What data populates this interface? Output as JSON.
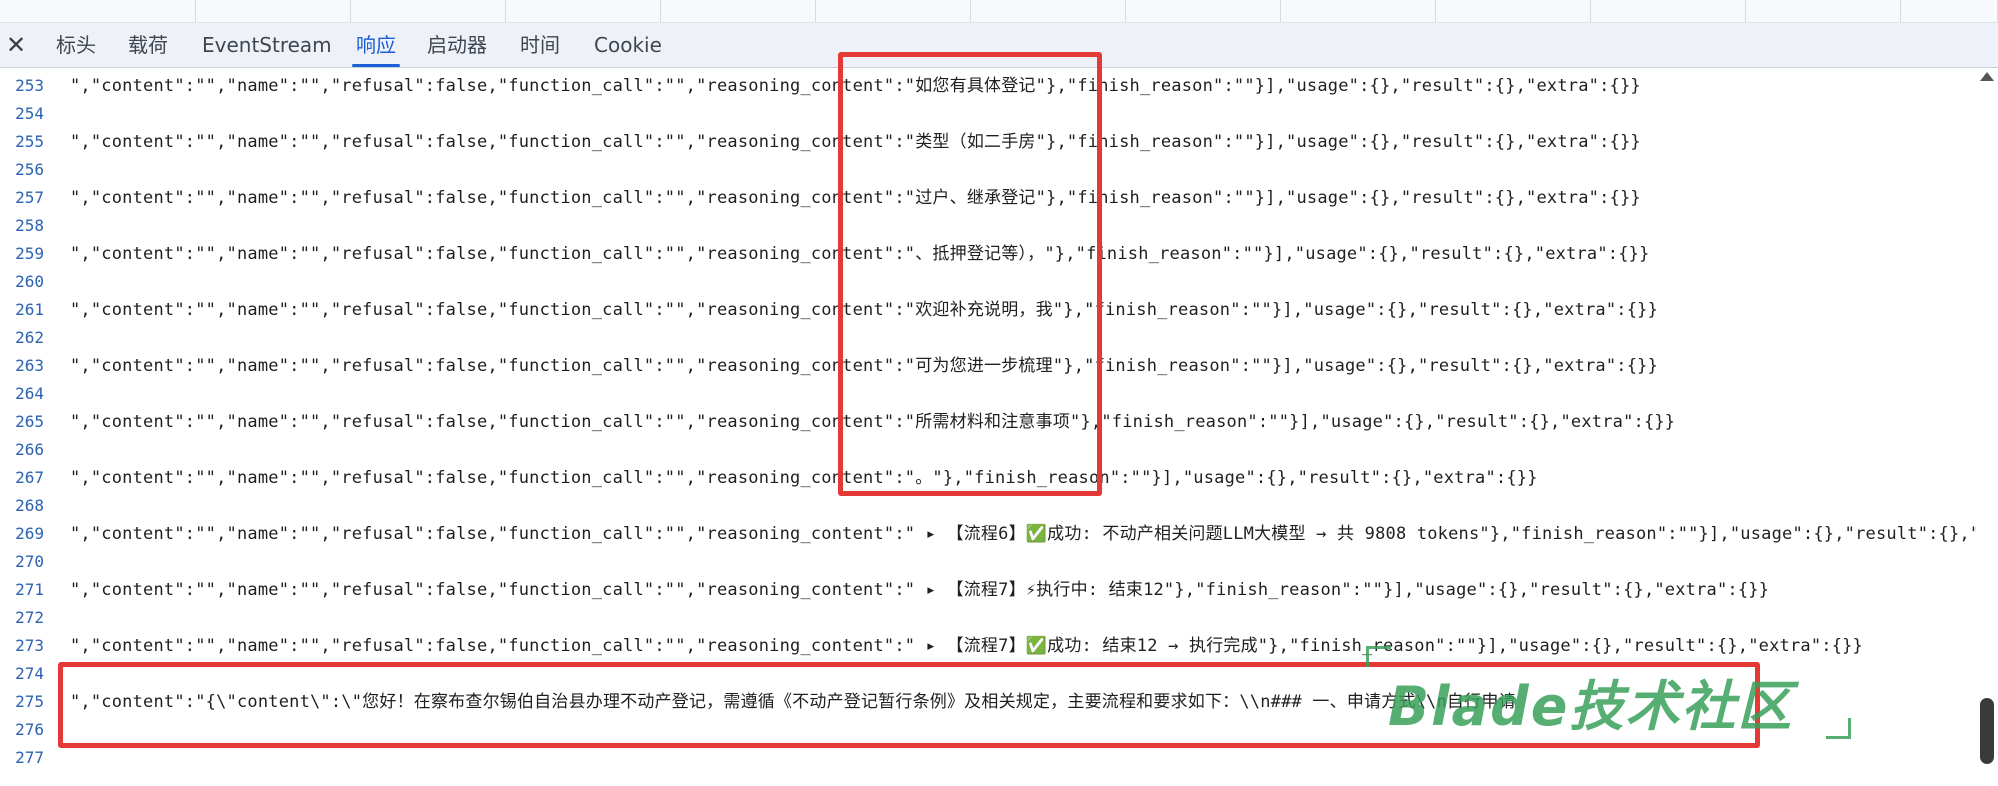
{
  "tabs": [
    {
      "label": "标头",
      "active": false
    },
    {
      "label": "载荷",
      "active": false
    },
    {
      "label": "EventStream",
      "active": false
    },
    {
      "label": "响应",
      "active": true
    },
    {
      "label": "启动器",
      "active": false
    },
    {
      "label": "时间",
      "active": false
    },
    {
      "label": "Cookie",
      "active": false
    }
  ],
  "close_label": "✕",
  "lines": [
    {
      "n": "253",
      "text": "\",\"content\":\"\",\"name\":\"\",\"refusal\":false,\"function_call\":\"\",\"reasoning_content\":\"如您有具体登记\"},\"finish_reason\":\"\"}],\"usage\":{},\"result\":{},\"extra\":{}}"
    },
    {
      "n": "254",
      "text": ""
    },
    {
      "n": "255",
      "text": "\",\"content\":\"\",\"name\":\"\",\"refusal\":false,\"function_call\":\"\",\"reasoning_content\":\"类型（如二手房\"},\"finish_reason\":\"\"}],\"usage\":{},\"result\":{},\"extra\":{}}"
    },
    {
      "n": "256",
      "text": ""
    },
    {
      "n": "257",
      "text": "\",\"content\":\"\",\"name\":\"\",\"refusal\":false,\"function_call\":\"\",\"reasoning_content\":\"过户、继承登记\"},\"finish_reason\":\"\"}],\"usage\":{},\"result\":{},\"extra\":{}}"
    },
    {
      "n": "258",
      "text": ""
    },
    {
      "n": "259",
      "text": "\",\"content\":\"\",\"name\":\"\",\"refusal\":false,\"function_call\":\"\",\"reasoning_content\":\"、抵押登记等），\"},\"finish_reason\":\"\"}],\"usage\":{},\"result\":{},\"extra\":{}}"
    },
    {
      "n": "260",
      "text": ""
    },
    {
      "n": "261",
      "text": "\",\"content\":\"\",\"name\":\"\",\"refusal\":false,\"function_call\":\"\",\"reasoning_content\":\"欢迎补充说明，我\"},\"finish_reason\":\"\"}],\"usage\":{},\"result\":{},\"extra\":{}}"
    },
    {
      "n": "262",
      "text": ""
    },
    {
      "n": "263",
      "text": "\",\"content\":\"\",\"name\":\"\",\"refusal\":false,\"function_call\":\"\",\"reasoning_content\":\"可为您进一步梳理\"},\"finish_reason\":\"\"}],\"usage\":{},\"result\":{},\"extra\":{}}"
    },
    {
      "n": "264",
      "text": ""
    },
    {
      "n": "265",
      "text": "\",\"content\":\"\",\"name\":\"\",\"refusal\":false,\"function_call\":\"\",\"reasoning_content\":\"所需材料和注意事项\"},\"finish_reason\":\"\"}],\"usage\":{},\"result\":{},\"extra\":{}}"
    },
    {
      "n": "266",
      "text": ""
    },
    {
      "n": "267",
      "text": "\",\"content\":\"\",\"name\":\"\",\"refusal\":false,\"function_call\":\"\",\"reasoning_content\":\"。\"},\"finish_reason\":\"\"}],\"usage\":{},\"result\":{},\"extra\":{}}"
    },
    {
      "n": "268",
      "text": ""
    },
    {
      "n": "269",
      "text": "\",\"content\":\"\",\"name\":\"\",\"refusal\":false,\"function_call\":\"\",\"reasoning_content\":\" ▸ 【流程6】✅成功: 不动产相关问题LLM大模型 → 共 9808 tokens\"},\"finish_reason\":\"\"}],\"usage\":{},\"result\":{},\""
    },
    {
      "n": "270",
      "text": ""
    },
    {
      "n": "271",
      "text": "\",\"content\":\"\",\"name\":\"\",\"refusal\":false,\"function_call\":\"\",\"reasoning_content\":\" ▸ 【流程7】⚡执行中: 结束12\"},\"finish_reason\":\"\"}],\"usage\":{},\"result\":{},\"extra\":{}}"
    },
    {
      "n": "272",
      "text": ""
    },
    {
      "n": "273",
      "text": "\",\"content\":\"\",\"name\":\"\",\"refusal\":false,\"function_call\":\"\",\"reasoning_content\":\" ▸ 【流程7】✅成功: 结束12 → 执行完成\"},\"finish_reason\":\"\"}],\"usage\":{},\"result\":{},\"extra\":{}}"
    },
    {
      "n": "274",
      "text": ""
    },
    {
      "n": "275",
      "text": "\",\"content\":\"{\\\"content\\\":\\\"您好！在察布查尔锡伯自治县办理不动产登记，需遵循《不动产登记暂行条例》及相关规定，主要流程和要求如下：\\\\n### 一、申请方式\\\\n自行申请"
    },
    {
      "n": "276",
      "text": ""
    },
    {
      "n": "277",
      "text": ""
    }
  ],
  "watermark": "Blade技术社区"
}
